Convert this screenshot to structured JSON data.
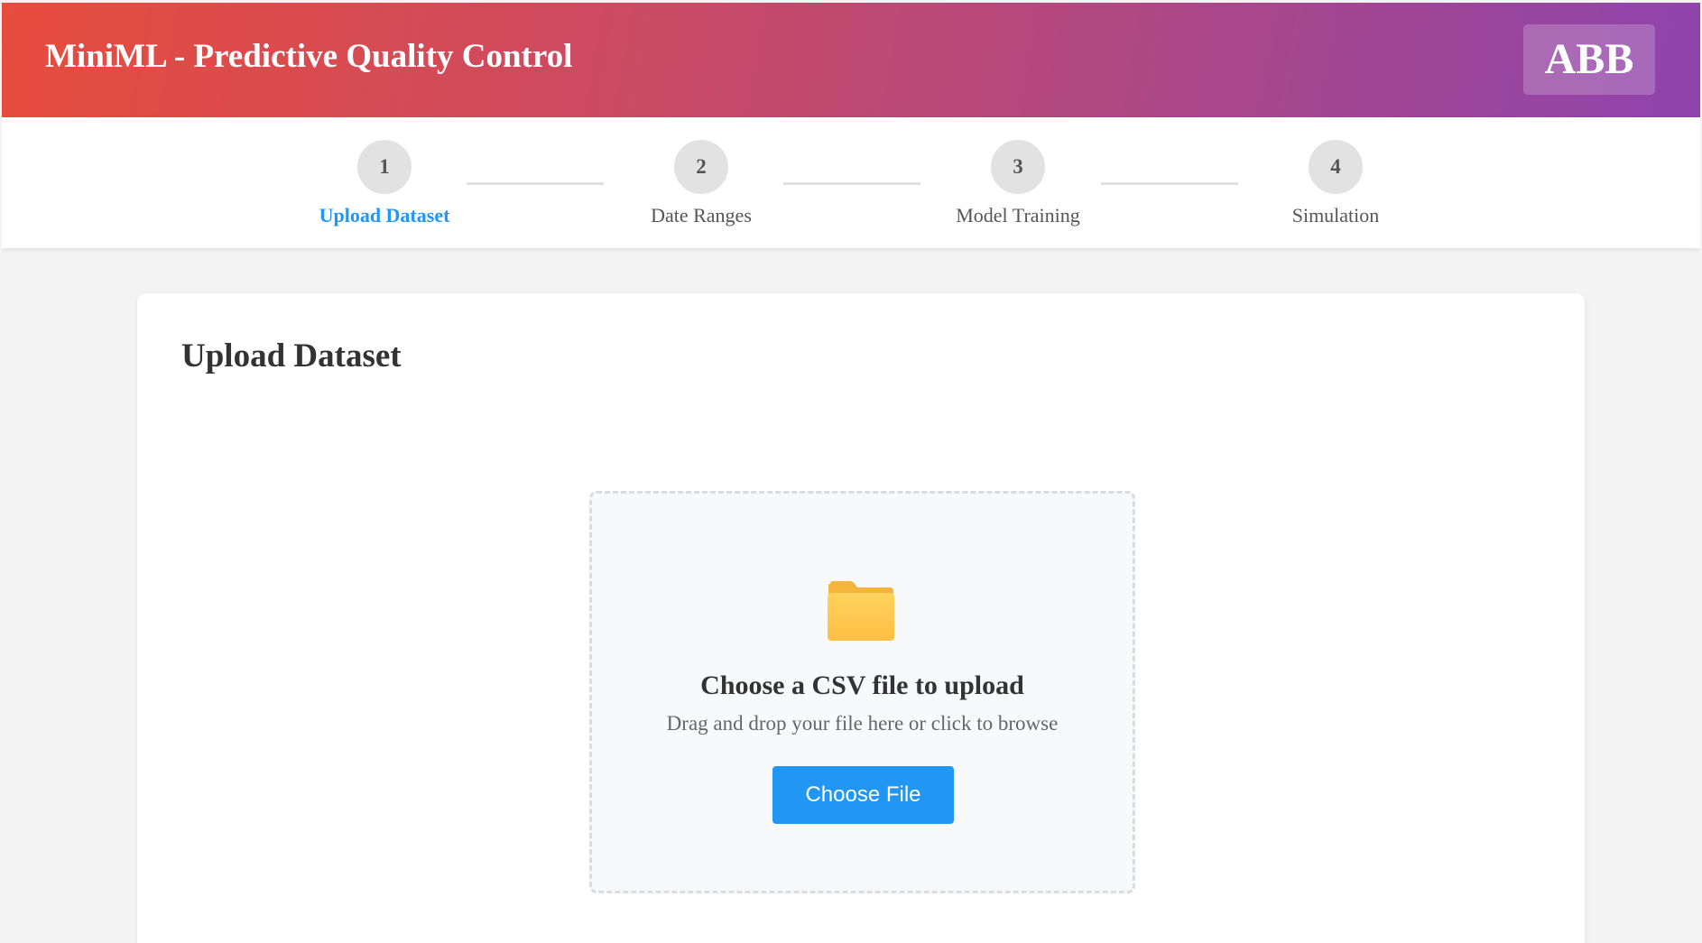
{
  "header": {
    "title": "MiniML - Predictive Quality Control",
    "logo_text": "ABB"
  },
  "steps": [
    {
      "number": "1",
      "label": "Upload Dataset",
      "active": true
    },
    {
      "number": "2",
      "label": "Date Ranges",
      "active": false
    },
    {
      "number": "3",
      "label": "Model Training",
      "active": false
    },
    {
      "number": "4",
      "label": "Simulation",
      "active": false
    }
  ],
  "card": {
    "title": "Upload Dataset"
  },
  "upload": {
    "icon": "folder-icon",
    "title": "Choose a CSV file to upload",
    "subtitle": "Drag and drop your file here or click to browse",
    "button_label": "Choose File"
  },
  "colors": {
    "header_gradient_start": "#e74c3c",
    "header_gradient_end": "#8e44ad",
    "accent": "#2196f3",
    "folder": "#ffc94d"
  }
}
